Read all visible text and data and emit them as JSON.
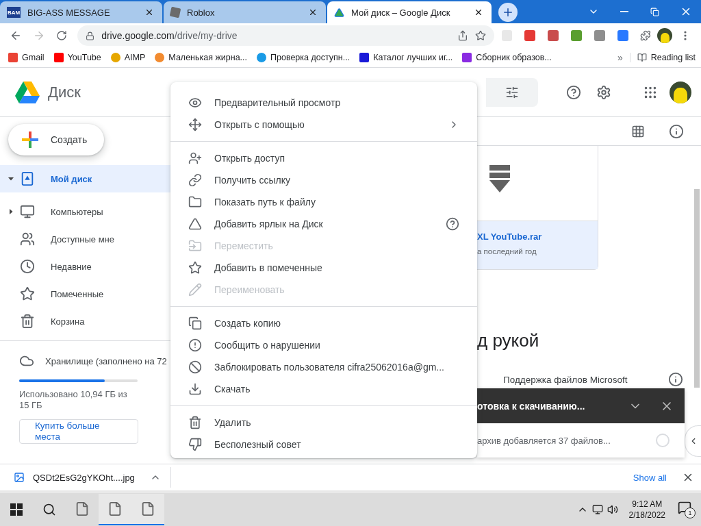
{
  "browser": {
    "tabs": [
      {
        "title": "BIG-ASS MESSAGE",
        "favicon_text": "BAM",
        "selected": false
      },
      {
        "title": "Roblox",
        "selected": false
      },
      {
        "title": "Мой диск – Google Диск",
        "selected": true
      }
    ],
    "address": {
      "host": "drive.google.com",
      "path": "/drive/my-drive"
    },
    "bookmarks": [
      {
        "label": "Gmail"
      },
      {
        "label": "YouTube"
      },
      {
        "label": "AIMP"
      },
      {
        "label": "Маленькая жирна..."
      },
      {
        "label": "Проверка доступн..."
      },
      {
        "label": "Каталог лучших иг..."
      },
      {
        "label": "Сборник образов..."
      }
    ],
    "overflow": "»",
    "reading_list": "Reading list"
  },
  "drive": {
    "product": "Диск",
    "create": "Создать",
    "nav": [
      {
        "label": "Мой диск",
        "selected": true,
        "expanded": true
      },
      {
        "label": "Компьютеры",
        "selected": false,
        "expanded": false
      },
      {
        "label": "Доступные мне",
        "selected": false
      },
      {
        "label": "Недавние",
        "selected": false
      },
      {
        "label": "Помеченные",
        "selected": false
      },
      {
        "label": "Корзина",
        "selected": false
      }
    ],
    "storage": {
      "label": "Хранилище (заполнено на 72",
      "level": 0.72,
      "usage": "Использовано 10,94 ГБ из 15 ГБ",
      "buy": "Купить больше места"
    },
    "file_card": {
      "name": "XL YouTube.rar",
      "meta": "а последний год"
    },
    "section_heading": "д рукой",
    "tip": "Поддержка файлов Microsoft"
  },
  "context_menu": {
    "groups": [
      [
        {
          "label": "Предварительный просмотр",
          "disabled": false
        },
        {
          "label": "Открыть с помощью",
          "disabled": false,
          "submenu": true
        }
      ],
      [
        {
          "label": "Открыть доступ",
          "disabled": false
        },
        {
          "label": "Получить ссылку",
          "disabled": false
        },
        {
          "label": "Показать путь к файлу",
          "disabled": false
        },
        {
          "label": "Добавить ярлык на Диск",
          "disabled": false,
          "help": true
        },
        {
          "label": "Переместить",
          "disabled": true
        },
        {
          "label": "Добавить в помеченные",
          "disabled": false
        },
        {
          "label": "Переименовать",
          "disabled": true
        }
      ],
      [
        {
          "label": "Создать копию",
          "disabled": false
        },
        {
          "label": "Сообщить о нарушении",
          "disabled": false
        },
        {
          "label": "Заблокировать пользователя cifra25062016a@gm...",
          "disabled": false
        },
        {
          "label": "Скачать",
          "disabled": false
        }
      ],
      [
        {
          "label": "Удалить",
          "disabled": false
        },
        {
          "label": "Бесполезный совет",
          "disabled": false
        }
      ]
    ]
  },
  "download_panel": {
    "title": "отовка к скачиванию...",
    "status": "архив добавляется 37 файлов..."
  },
  "download_shelf": {
    "file": "QSDt2EsG2gYKOht....jpg",
    "show_all": "Show all"
  },
  "taskbar": {
    "apps": [
      {
        "running": false
      },
      {
        "running": true
      },
      {
        "running": true
      }
    ],
    "time": "9:12 AM",
    "date": "2/18/2022",
    "notifications": "1"
  }
}
